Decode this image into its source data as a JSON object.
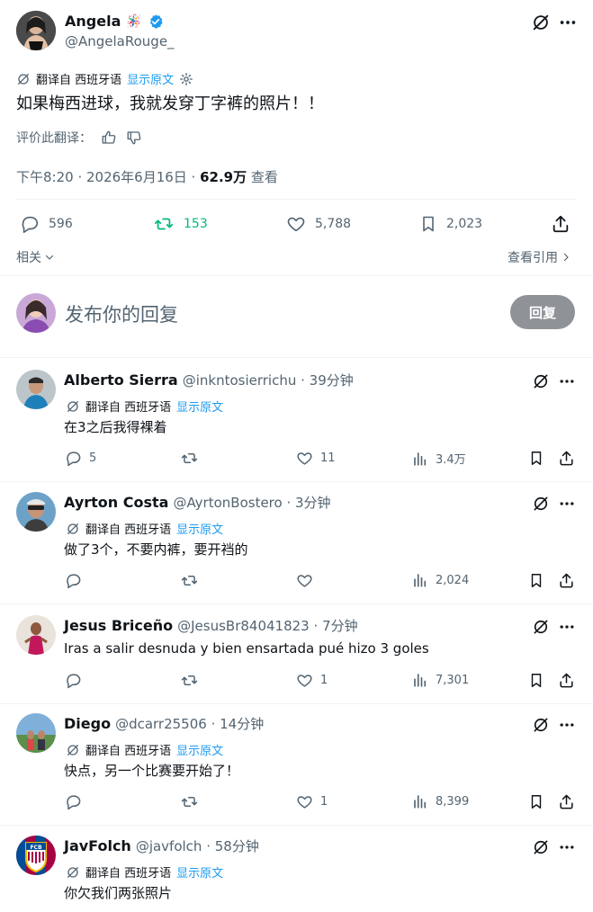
{
  "main_tweet": {
    "author_name": "Angela",
    "author_emoji": "🪅",
    "author_handle": "@AngelaRouge_",
    "translate_label": "翻译自 西班牙语",
    "show_original": "显示原文",
    "text": "如果梅西进球，我就发穿丁字裤的照片！！",
    "rate_label": "评价此翻译：",
    "time": "下午8:20 · 2026年6月16日 · ",
    "views_count": "62.9万",
    "views_label": " 查看",
    "stats": {
      "replies": "596",
      "retweets": "153",
      "likes": "5,788",
      "bookmarks": "2,023"
    },
    "related_label": "相关",
    "quotes_label": "查看引用"
  },
  "composer": {
    "placeholder": "发布你的回复",
    "reply_button": "回复"
  },
  "replies": [
    {
      "name": "Alberto Sierra",
      "handle": "@inkntosierrichu",
      "time": " · 39分钟",
      "has_translate": true,
      "translate_label": "翻译自 西班牙语",
      "show_original": "显示原文",
      "text": "在3之后我得裸着",
      "replies": "5",
      "retweets": "",
      "likes": "11",
      "views": "3.4万"
    },
    {
      "name": "Ayrton Costa",
      "handle": "@AyrtonBostero",
      "time": " · 3分钟",
      "has_translate": true,
      "translate_label": "翻译自 西班牙语",
      "show_original": "显示原文",
      "text": "做了3个，不要内裤，要开裆的",
      "replies": "",
      "retweets": "",
      "likes": "",
      "views": "2,024"
    },
    {
      "name": "Jesus Briceño",
      "handle": "@JesusBr84041823",
      "time": " · 7分钟",
      "has_translate": false,
      "text": "Iras a salir desnuda y bien ensartada pué hizo 3 goles",
      "replies": "",
      "retweets": "",
      "likes": "1",
      "views": "7,301"
    },
    {
      "name": "Diego",
      "handle": "@dcarr25506",
      "time": " · 14分钟",
      "has_translate": true,
      "translate_label": "翻译自 西班牙语",
      "show_original": "显示原文",
      "text": "快点，另一个比赛要开始了！",
      "replies": "",
      "retweets": "",
      "likes": "1",
      "views": "8,399"
    },
    {
      "name": "JavFolch",
      "handle": "@javfolch",
      "time": " · 58分钟",
      "has_translate": true,
      "translate_label": "翻译自 西班牙语",
      "show_original": "显示原文",
      "text": "你欠我们两张照片",
      "replies": "",
      "retweets": "",
      "likes": "",
      "views": ""
    }
  ],
  "colors": {
    "accent": "#1d9bf0",
    "retweet_green": "#00ba7c",
    "text_primary": "#0f1419",
    "text_secondary": "#536471",
    "reply_button_bg": "#8f9398"
  }
}
